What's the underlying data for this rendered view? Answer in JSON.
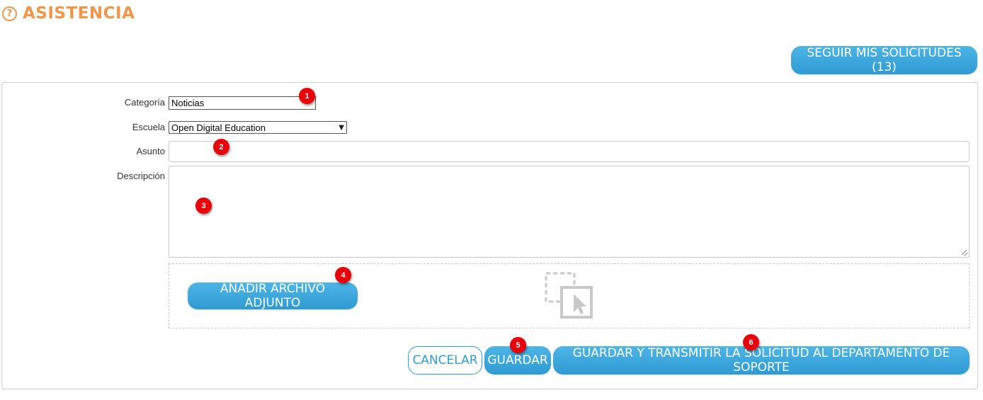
{
  "header": {
    "help_icon": "?",
    "title": "ASISTENCIA"
  },
  "toolbar": {
    "track_requests_label": "SEGUIR MIS SOLICITUDES (13)"
  },
  "form": {
    "category_label": "Categoría",
    "category_value": "Noticias",
    "school_label": "Escuela",
    "school_value": "Open Digital Education",
    "subject_label": "Asunto",
    "subject_value": "",
    "description_label": "Descripción",
    "description_value": "",
    "attach_label": "AÑADIR ARCHIVO ADJUNTO",
    "drop_icon": "drag-drop-icon"
  },
  "actions": {
    "cancel_label": "CANCELAR",
    "save_label": "GUARDAR",
    "submit_label": "GUARDAR Y TRANSMITIR LA SOLICITUD AL DEPARTAMENTO DE SOPORTE"
  },
  "badges": [
    "1",
    "2",
    "3",
    "4",
    "5",
    "6"
  ],
  "colors": {
    "accent_orange": "#f0954a",
    "button_blue": "#2f9bd2",
    "badge_red": "#e8000b"
  }
}
